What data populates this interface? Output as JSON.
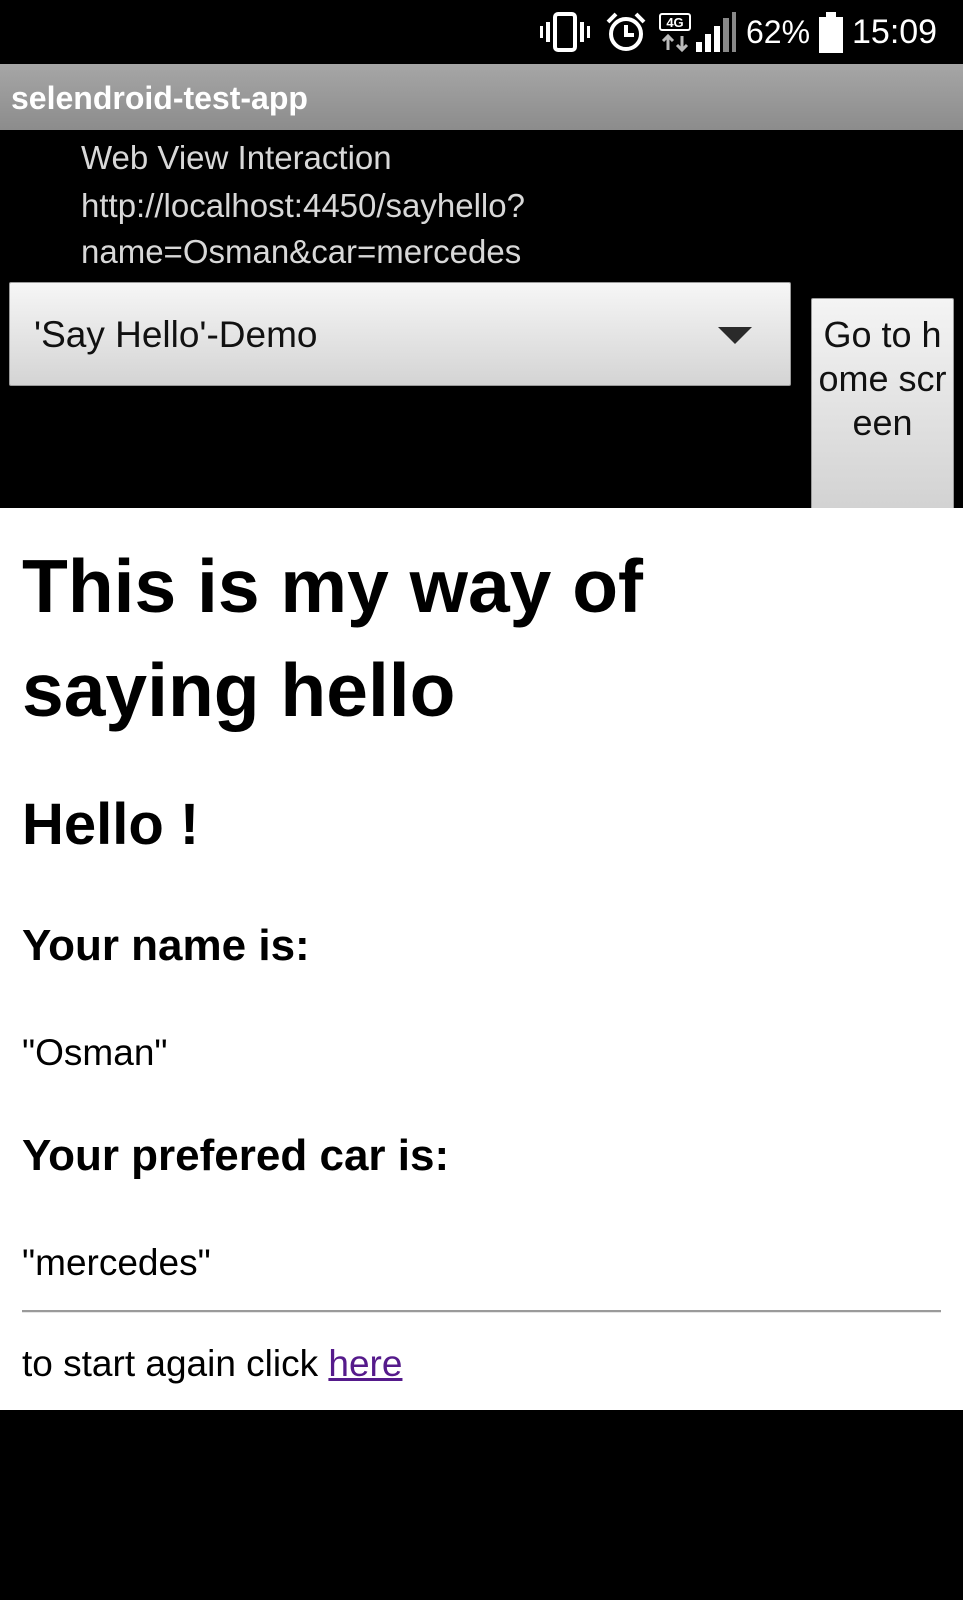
{
  "status_bar": {
    "battery_percent": "62%",
    "time": "15:09",
    "network_type": "4G",
    "icons": [
      "vibrate-icon",
      "alarm-icon",
      "network-4g-icon",
      "signal-icon",
      "battery-icon"
    ]
  },
  "action_bar": {
    "title": "selendroid-test-app"
  },
  "header": {
    "activity_title": "Web View Interaction",
    "url_line_1": "http://localhost:4450/sayhello?",
    "url_line_2": "name=Osman&car=mercedes"
  },
  "controls": {
    "spinner_selected": "'Say Hello'-Demo",
    "home_button_label": "Go to home screen"
  },
  "webview": {
    "heading": "This is my way of saying hello",
    "greeting": "Hello !",
    "name_label": "Your name is:",
    "name_value": "\"Osman\"",
    "car_label": "Your prefered car is:",
    "car_value": "\"mercedes\"",
    "footer_text": "to start again click ",
    "footer_link": "here",
    "link_color": "#551a8b"
  },
  "colors": {
    "action_bar": "#999999",
    "background": "#000000",
    "webview_background": "#ffffff"
  }
}
